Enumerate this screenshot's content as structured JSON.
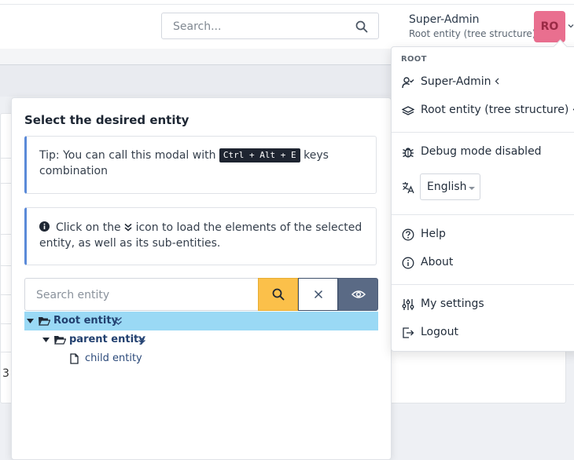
{
  "header": {
    "search_placeholder": "Search...",
    "user_name": "Super-Admin",
    "user_entity": "Root entity (tree structure)",
    "avatar_initials": "RO"
  },
  "background": {
    "row_fragment": "3"
  },
  "modal": {
    "title": "Select the desired entity",
    "tip_before": "Tip: You can call this modal with ",
    "tip_kbd": "Ctrl + Alt + E",
    "tip_after": " keys combination",
    "info_before": "Click on the ",
    "info_after": " icon to load the elements of the selected entity, as well as its sub-entities.",
    "entity_search_placeholder": "Search entity",
    "tree": [
      {
        "label": "Root entity",
        "level": 0,
        "type": "folder-open",
        "selected": true
      },
      {
        "label": "parent entity",
        "level": 1,
        "type": "folder-open",
        "selected": false
      },
      {
        "label": "child entity",
        "level": 2,
        "type": "file",
        "selected": false
      }
    ]
  },
  "menu": {
    "section_header": "ROOT",
    "profile_item": "Super-Admin",
    "entity_item": "Root entity (tree structure)",
    "debug_item": "Debug mode disabled",
    "language_value": "English",
    "help_item": "Help",
    "about_item": "About",
    "settings_item": "My settings",
    "logout_item": "Logout"
  },
  "colors": {
    "avatar_bg": "#e96f8f",
    "search_button": "#fbc04a",
    "view_button": "#5a6a85",
    "tree_selected": "#9ad9f5",
    "alert_accent": "#5b8ad8"
  }
}
